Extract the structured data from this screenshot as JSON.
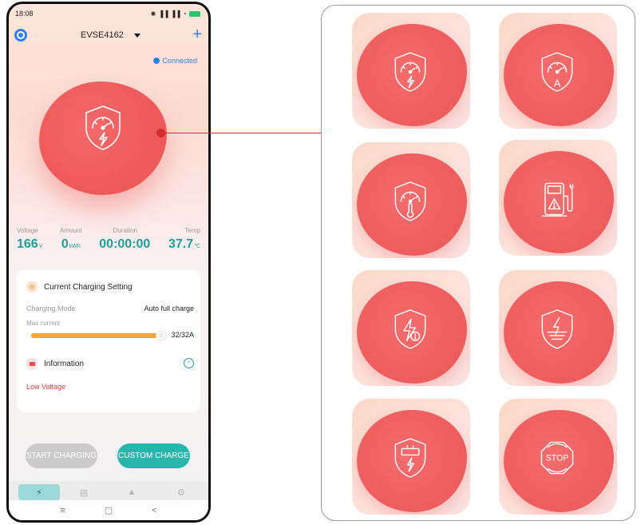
{
  "status": {
    "time": "18:08",
    "signal": "✱ ▐▐ ▐▐ ◔"
  },
  "header": {
    "device": "EVSE4162",
    "add": "+"
  },
  "connection": {
    "status": "Connected"
  },
  "metrics": [
    {
      "label": "Voltage",
      "value": "166",
      "unit": "V"
    },
    {
      "label": "Amount",
      "value": "0",
      "unit": "kWh"
    },
    {
      "label": "Duration",
      "value": "00:00:00",
      "unit": ""
    },
    {
      "label": "Temp",
      "value": "37.7",
      "unit": "℃"
    }
  ],
  "setting": {
    "title": "Current Charging Setting",
    "mode_label": "Charging Mode",
    "mode_value": "Auto full charge",
    "max_label": "Max current",
    "current": 32,
    "max": 32,
    "current_text": "32/32A",
    "knob_text": "|||"
  },
  "information": {
    "title": "Information",
    "message": "Low Voltage"
  },
  "buttons": {
    "start": "START CHARGING",
    "custom": "CUSTOM CHARGE"
  },
  "tabs": [
    {
      "icon": "lightning-icon",
      "glyph": "⚡",
      "active": true
    },
    {
      "icon": "document-icon",
      "glyph": "▤",
      "active": false
    },
    {
      "icon": "bell-icon",
      "glyph": "▲",
      "active": false
    },
    {
      "icon": "settings-icon",
      "glyph": "⚙",
      "active": false
    }
  ],
  "nav": {
    "menu": "≡",
    "home": "▢",
    "back": "<"
  },
  "colors": {
    "accent_blue": "#2f80ed",
    "teal": "#27b5ac",
    "coral": "#ef5f5f",
    "warning": "#e03b3b",
    "slider": "#f5a43c"
  },
  "status_icons": [
    {
      "name": "charging-shield-icon"
    },
    {
      "name": "ampere-shield-icon",
      "glyph": "A"
    },
    {
      "name": "temperature-shield-icon"
    },
    {
      "name": "charging-station-warning-icon"
    },
    {
      "name": "lightning-warning-shield-icon"
    },
    {
      "name": "ground-fault-shield-icon"
    },
    {
      "name": "battery-shield-icon"
    },
    {
      "name": "stop-sign-icon",
      "glyph": "STOP"
    }
  ]
}
